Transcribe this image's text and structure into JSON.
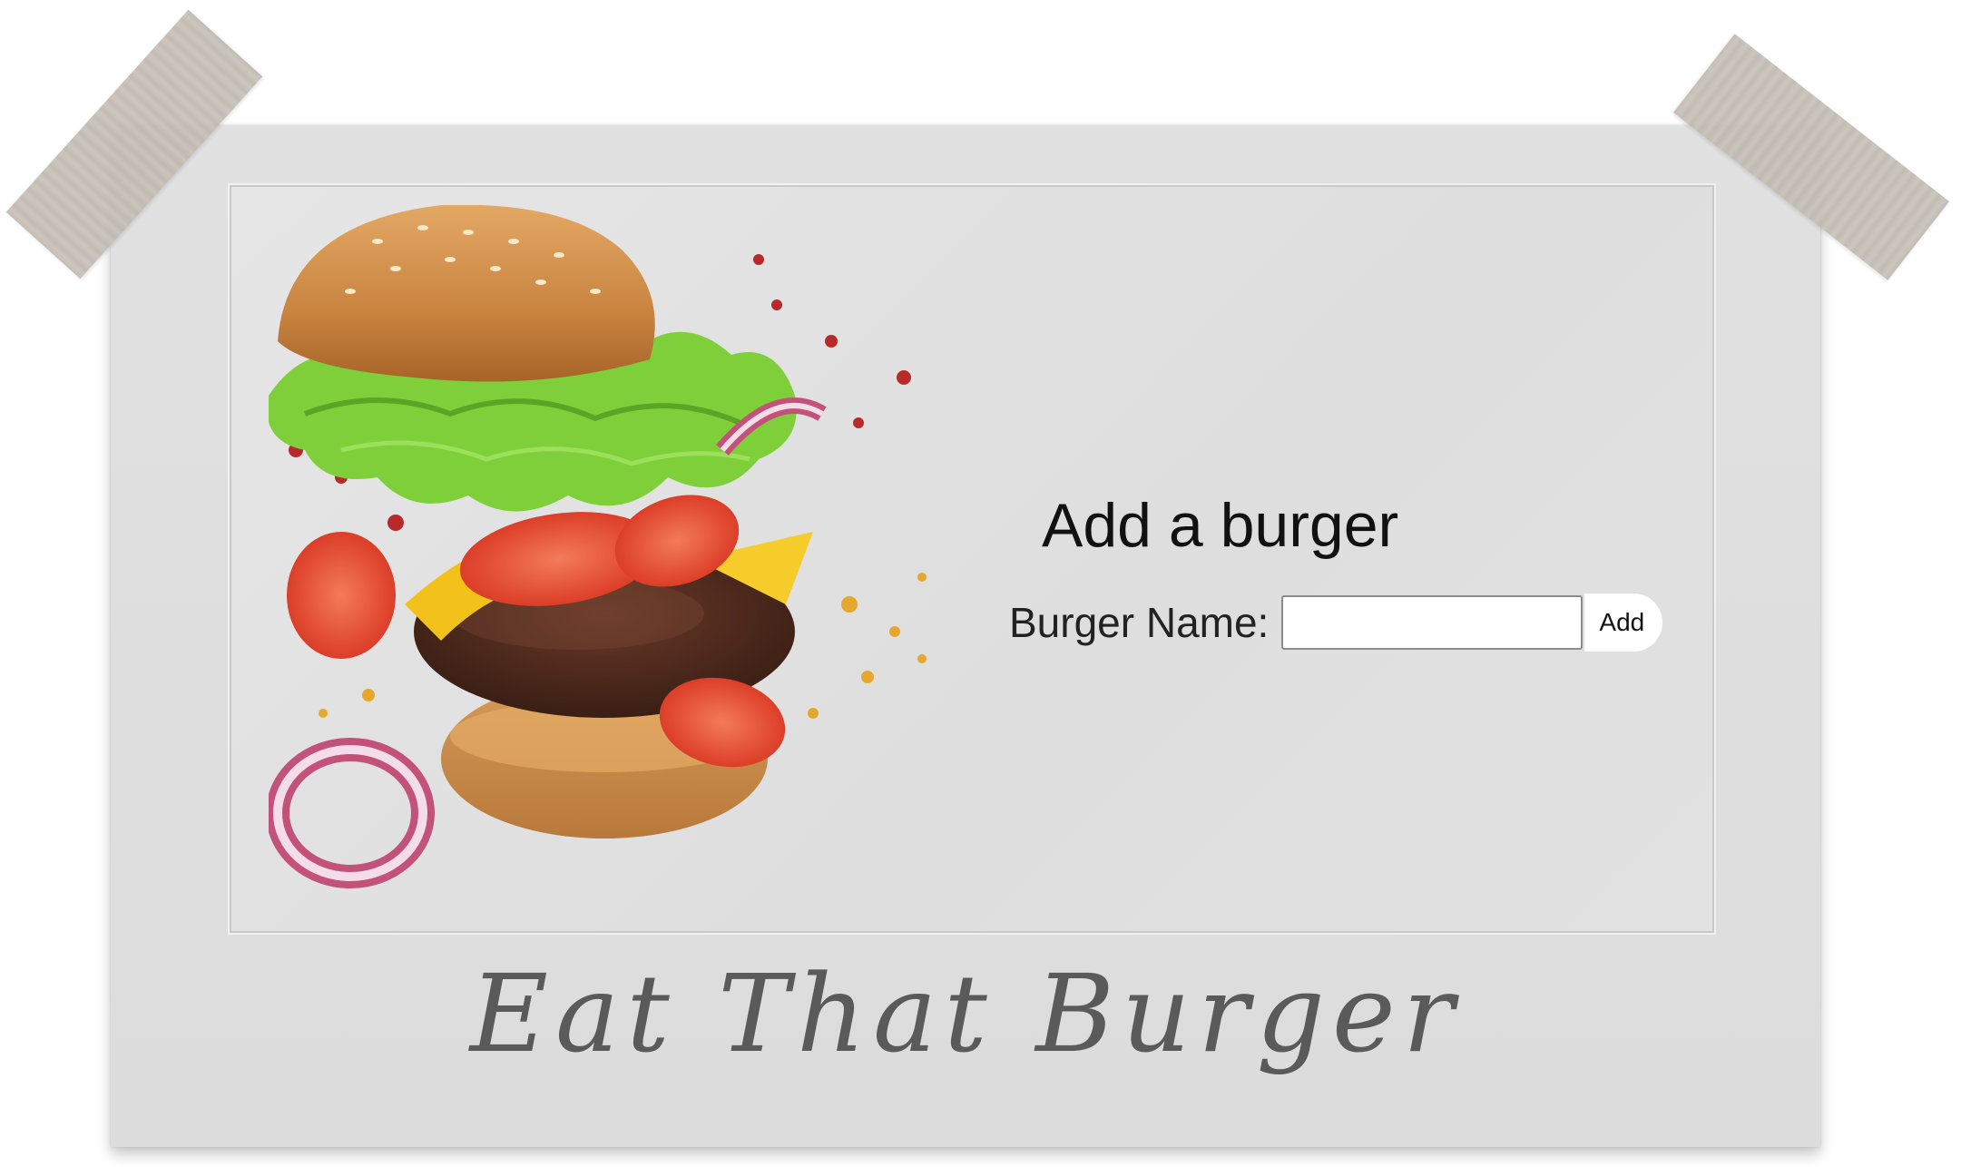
{
  "app": {
    "heading": "Add a burger",
    "caption": "Eat That Burger"
  },
  "form": {
    "label": "Burger Name:",
    "input_value": "",
    "input_placeholder": "",
    "add_label": "Add"
  },
  "colors": {
    "frame": "#dcdcdc",
    "photo_background": "#e2e2e2",
    "caption_text": "#5a5a5a",
    "tape": "#c2bbb3"
  },
  "icons": {
    "burger_image": "burger-illustration"
  }
}
